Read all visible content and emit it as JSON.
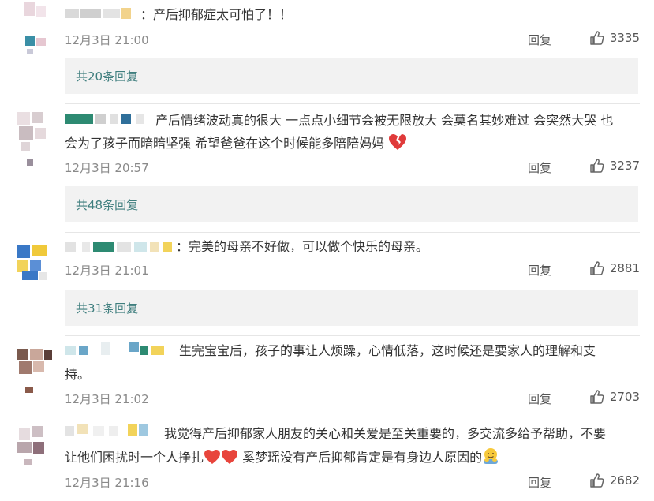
{
  "comments": [
    {
      "text": "产后抑郁症太可怕了！！",
      "time": "12月3日 21:00",
      "reply_label": "回复",
      "likes": "3335",
      "thread_label": "共20条回复"
    },
    {
      "text_line1": "产后情绪波动真的很大 一点点小细节会被无限放大 会莫名其妙难过 会突然大哭 也",
      "text_line2": "会为了孩子而暗暗坚强 希望爸爸在这个时候能多陪陪妈妈",
      "time": "12月3日 20:57",
      "reply_label": "回复",
      "likes": "3237",
      "thread_label": "共48条回复"
    },
    {
      "text": "完美的母亲不好做，可以做个快乐的母亲。",
      "time": "12月3日 21:01",
      "reply_label": "回复",
      "likes": "2881",
      "thread_label": "共31条回复"
    },
    {
      "text_line1": "生完宝宝后，孩子的事让人烦躁，心情低落，这时候还是要家人的理解和支",
      "text_line2": "持。",
      "time": "12月3日 21:02",
      "reply_label": "回复",
      "likes": "2703"
    },
    {
      "text_line1": "我觉得产后抑郁家人朋友的关心和关爱是至关重要的，多交流多给予帮助，不要",
      "text_line2a": "让他们困扰时一个人挣扎",
      "text_line2b": "奚梦瑶没有产后抑郁肯定是有身边人原因的",
      "time": "12月3日 21:16",
      "reply_label": "回复",
      "likes": "2682"
    }
  ],
  "colors": {
    "link": "#3f7e7e",
    "meta": "#8a8a8a",
    "reply_bg": "#f2f2f2"
  },
  "icons": [
    "thumbs-up-icon",
    "broken-heart-icon",
    "heart-icon",
    "hugging-face-icon"
  ]
}
